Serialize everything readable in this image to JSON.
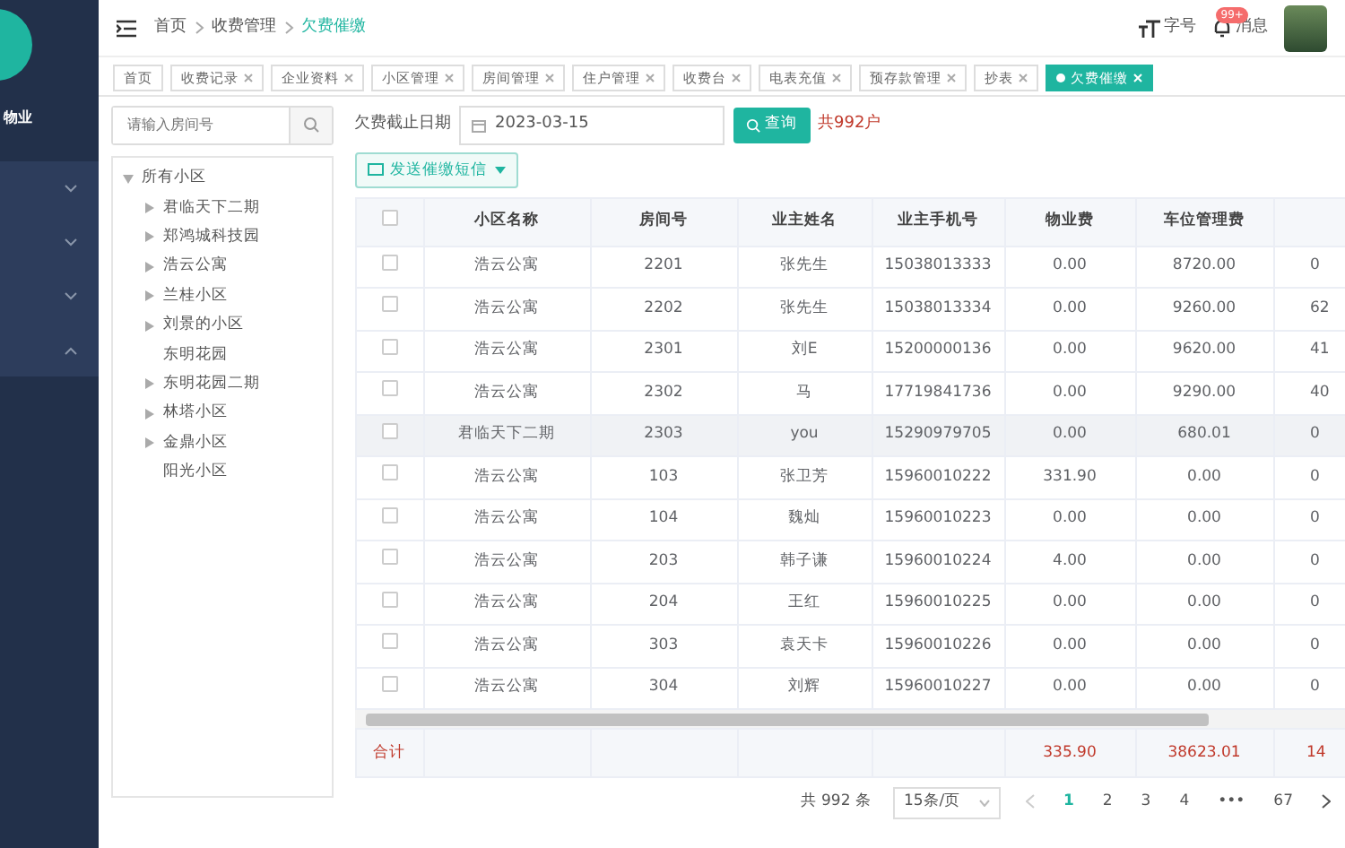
{
  "sidebar": {
    "brand": "物业",
    "items": [
      {
        "expanded": false
      },
      {
        "expanded": false
      },
      {
        "expanded": false
      },
      {
        "expanded": true
      }
    ]
  },
  "header": {
    "breadcrumb": [
      {
        "label": "首页",
        "current": false
      },
      {
        "label": "收费管理",
        "current": false
      },
      {
        "label": "欠费催缴",
        "current": true
      }
    ],
    "font_size": "字号",
    "messages": {
      "label": "消息",
      "badge": "99+"
    }
  },
  "tabs": [
    {
      "label": "首页",
      "closable": false,
      "selected": false
    },
    {
      "label": "收费记录",
      "closable": true,
      "selected": false
    },
    {
      "label": "企业资料",
      "closable": true,
      "selected": false
    },
    {
      "label": "小区管理",
      "closable": true,
      "selected": false
    },
    {
      "label": "房间管理",
      "closable": true,
      "selected": false
    },
    {
      "label": "住户管理",
      "closable": true,
      "selected": false
    },
    {
      "label": "收费台",
      "closable": true,
      "selected": false
    },
    {
      "label": "电表充值",
      "closable": true,
      "selected": false
    },
    {
      "label": "预存款管理",
      "closable": true,
      "selected": false
    },
    {
      "label": "抄表",
      "closable": true,
      "selected": false
    },
    {
      "label": "欠费催缴",
      "closable": true,
      "selected": true
    }
  ],
  "tree_search": {
    "placeholder": "请输入房间号"
  },
  "tree": [
    {
      "label": "所有小区",
      "expandable": true,
      "expanded": true,
      "children": [
        {
          "label": "君临天下二期",
          "expandable": true
        },
        {
          "label": "郑鸿城科技园",
          "expandable": true
        },
        {
          "label": "浩云公寓",
          "expandable": true
        },
        {
          "label": "兰桂小区",
          "expandable": true
        },
        {
          "label": "刘景的小区",
          "expandable": true
        },
        {
          "label": "东明花园",
          "expandable": false
        },
        {
          "label": "东明花园二期",
          "expandable": true
        },
        {
          "label": "林塔小区",
          "expandable": true
        },
        {
          "label": "金鼎小区",
          "expandable": true
        },
        {
          "label": "阳光小区",
          "expandable": false
        }
      ]
    }
  ],
  "filter": {
    "date_label": "欠费截止日期",
    "date_value": "2023-03-15",
    "query_button": "查询",
    "count": "共992户"
  },
  "send_button": "发送催缴短信",
  "table": {
    "all_checked": false,
    "columns": [
      "小区名称",
      "房间号",
      "业主姓名",
      "业主手机号",
      "物业费",
      "车位管理费"
    ],
    "rows": [
      {
        "checked": false,
        "highlighted": false,
        "cells": [
          "浩云公寓",
          "2201",
          "张先生",
          "15038013333",
          "0.00",
          "8720.00",
          "0"
        ]
      },
      {
        "checked": false,
        "highlighted": false,
        "cells": [
          "浩云公寓",
          "2202",
          "张先生",
          "15038013334",
          "0.00",
          "9260.00",
          "62"
        ]
      },
      {
        "checked": false,
        "highlighted": false,
        "cells": [
          "浩云公寓",
          "2301",
          "刘E",
          "15200000136",
          "0.00",
          "9620.00",
          "41"
        ]
      },
      {
        "checked": false,
        "highlighted": false,
        "cells": [
          "浩云公寓",
          "2302",
          "马",
          "17719841736",
          "0.00",
          "9290.00",
          "40"
        ]
      },
      {
        "checked": false,
        "highlighted": true,
        "cells": [
          "君临天下二期",
          "2303",
          "you",
          "15290979705",
          "0.00",
          "680.01",
          "0"
        ]
      },
      {
        "checked": false,
        "highlighted": false,
        "cells": [
          "浩云公寓",
          "103",
          "张卫芳",
          "15960010222",
          "331.90",
          "0.00",
          "0"
        ]
      },
      {
        "checked": false,
        "highlighted": false,
        "cells": [
          "浩云公寓",
          "104",
          "魏灿",
          "15960010223",
          "0.00",
          "0.00",
          "0"
        ]
      },
      {
        "checked": false,
        "highlighted": false,
        "cells": [
          "浩云公寓",
          "203",
          "韩子谦",
          "15960010224",
          "4.00",
          "0.00",
          "0"
        ]
      },
      {
        "checked": false,
        "highlighted": false,
        "cells": [
          "浩云公寓",
          "204",
          "王红",
          "15960010225",
          "0.00",
          "0.00",
          "0"
        ]
      },
      {
        "checked": false,
        "highlighted": false,
        "cells": [
          "浩云公寓",
          "303",
          "袁天卡",
          "15960010226",
          "0.00",
          "0.00",
          "0"
        ]
      },
      {
        "checked": false,
        "highlighted": false,
        "cells": [
          "浩云公寓",
          "304",
          "刘辉",
          "15960010227",
          "0.00",
          "0.00",
          "0"
        ]
      }
    ],
    "total": {
      "label": "合计",
      "cells": [
        "",
        "",
        "",
        "",
        "335.90",
        "38623.01",
        "14"
      ]
    }
  },
  "pagination": {
    "total": "共 992 条",
    "page_size": "15条/页",
    "prev_disabled": true,
    "pages": [
      {
        "label": "1",
        "selected": true
      },
      {
        "label": "2",
        "selected": false
      },
      {
        "label": "3",
        "selected": false
      },
      {
        "label": "4",
        "selected": false
      },
      {
        "label": "•••",
        "selected": false
      },
      {
        "label": "67",
        "selected": false
      }
    ]
  }
}
